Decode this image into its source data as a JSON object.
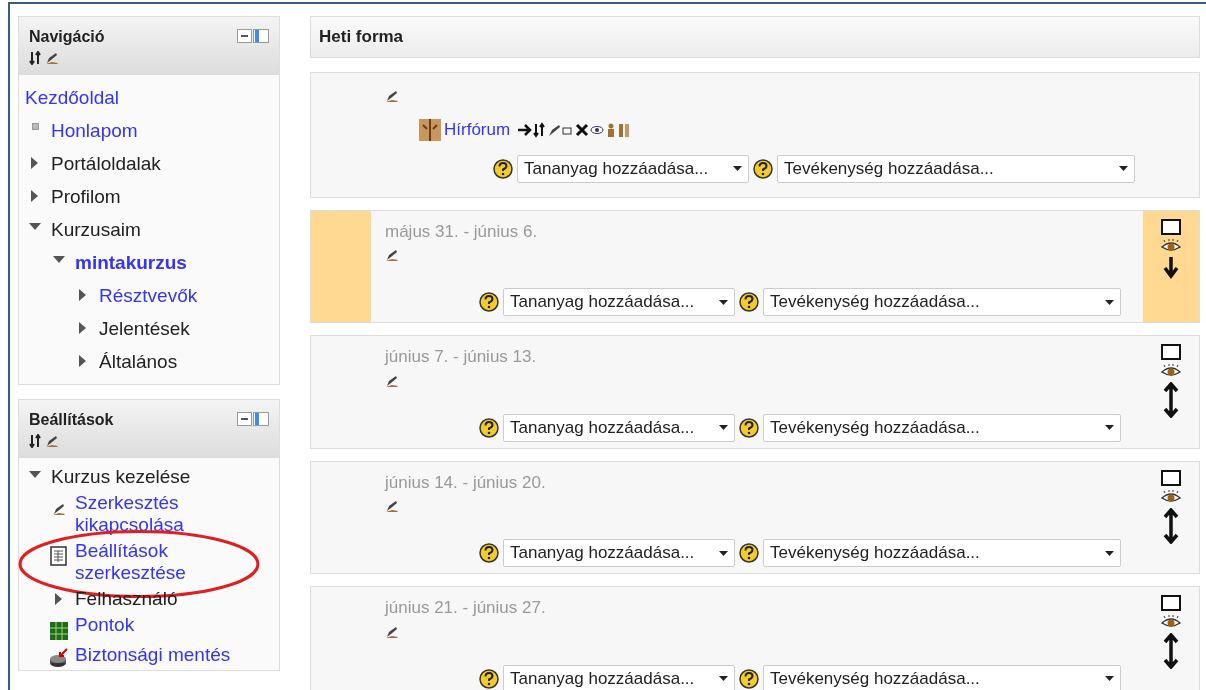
{
  "navigation": {
    "title": "Navigáció",
    "items": [
      {
        "label": "Kezdőoldal",
        "kind": "plain",
        "link": true,
        "current": false
      },
      {
        "label": "Honlapom",
        "kind": "leaf",
        "link": true,
        "current": false
      },
      {
        "label": "Portáloldalak",
        "kind": "branch",
        "expanded": false,
        "link": false,
        "current": false
      },
      {
        "label": "Profilom",
        "kind": "branch",
        "expanded": false,
        "link": false,
        "current": false
      },
      {
        "label": "Kurzusaim",
        "kind": "branch",
        "expanded": true,
        "link": false,
        "current": false,
        "children": [
          {
            "label": "mintakurzus",
            "kind": "branch",
            "expanded": true,
            "link": true,
            "current": true,
            "children": [
              {
                "label": "Résztvevők",
                "kind": "branch",
                "expanded": false,
                "link": true,
                "current": false
              },
              {
                "label": "Jelentések",
                "kind": "branch",
                "expanded": false,
                "link": false,
                "current": false
              },
              {
                "label": "Általános",
                "kind": "branch",
                "expanded": false,
                "link": false,
                "current": false
              }
            ]
          }
        ]
      }
    ]
  },
  "settings": {
    "title": "Beállítások",
    "items": [
      {
        "label": "Kurzus kezelése",
        "kind": "branch",
        "expanded": true,
        "link": false,
        "current": false,
        "children": [
          {
            "label": "Szerkesztés kikapcsolása",
            "kind": "edit",
            "link": true,
            "current": false,
            "circled": false
          },
          {
            "label": "Beállítások szerkesztése",
            "kind": "form",
            "link": true,
            "current": false,
            "circled": true
          },
          {
            "label": "Felhasználó",
            "kind": "branch",
            "expanded": false,
            "link": false,
            "current": false,
            "circled": false
          },
          {
            "label": "Pontok",
            "kind": "grades",
            "link": true,
            "current": false,
            "circled": false
          },
          {
            "label": "Biztonsági mentés",
            "kind": "backup",
            "link": true,
            "current": false,
            "circled": false
          }
        ]
      }
    ]
  },
  "course": {
    "title": "Heti forma",
    "general": {
      "activity": {
        "label": "Hírfórum"
      },
      "resource_select": "Tananyag hozzáadása...",
      "activity_select": "Tevékenység hozzáadása..."
    },
    "weeks": [
      {
        "dates": "május 31. - június 6.",
        "current": true,
        "kind": "down",
        "resource_select": "Tananyag hozzáadása...",
        "activity_select": "Tevékenység hozzáadása..."
      },
      {
        "dates": "június 7. - június 13.",
        "current": false,
        "kind": "updown",
        "resource_select": "Tananyag hozzáadása...",
        "activity_select": "Tevékenység hozzáadása..."
      },
      {
        "dates": "június 14. - június 20.",
        "current": false,
        "kind": "updown",
        "resource_select": "Tananyag hozzáadása...",
        "activity_select": "Tevékenység hozzáadása..."
      },
      {
        "dates": "június 21. - június 27.",
        "current": false,
        "kind": "updown",
        "resource_select": "Tananyag hozzáadása...",
        "activity_select": "Tevékenység hozzáadása..."
      }
    ]
  }
}
